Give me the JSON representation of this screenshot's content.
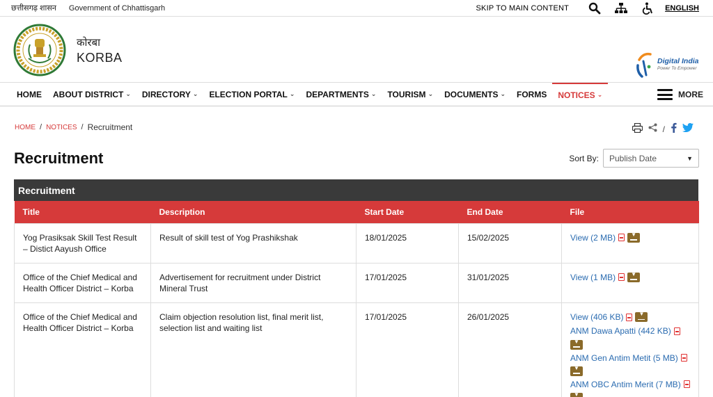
{
  "topbar": {
    "state_hindi": "छत्तीसगढ़ शासन",
    "state_english": "Government of Chhattisgarh",
    "skip": "SKIP TO MAIN CONTENT",
    "language": "ENGLISH",
    "icons": [
      "search-icon",
      "sitemap-icon",
      "accessibility-icon"
    ]
  },
  "header": {
    "district_hindi": "कोरबा",
    "district_english": "KORBA",
    "digital_india_title": "Digital India",
    "digital_india_tagline": "Power To Empower"
  },
  "nav": {
    "items": [
      {
        "label": "HOME",
        "dropdown": false
      },
      {
        "label": "ABOUT DISTRICT",
        "dropdown": true
      },
      {
        "label": "DIRECTORY",
        "dropdown": true
      },
      {
        "label": "ELECTION PORTAL",
        "dropdown": true
      },
      {
        "label": "DEPARTMENTS",
        "dropdown": true
      },
      {
        "label": "TOURISM",
        "dropdown": true
      },
      {
        "label": "DOCUMENTS",
        "dropdown": true
      },
      {
        "label": "FORMS",
        "dropdown": false
      },
      {
        "label": "NOTICES",
        "dropdown": true,
        "active": true
      }
    ],
    "more": "MORE"
  },
  "breadcrumb": {
    "home": "HOME",
    "notices": "NOTICES",
    "current": "Recruitment"
  },
  "share_sep": "/",
  "page_title": "Recruitment",
  "sort": {
    "label": "Sort By:",
    "value": "Publish Date"
  },
  "table": {
    "caption": "Recruitment",
    "headers": [
      "Title",
      "Description",
      "Start Date",
      "End Date",
      "File"
    ],
    "rows": [
      {
        "title": "Yog Prasiksak Skill Test Result – Distict Aayush Office",
        "description": "Result of skill test of Yog Prashikshak",
        "start": "18/01/2025",
        "end": "15/02/2025",
        "files": [
          "View (2 MB)"
        ]
      },
      {
        "title": "Office of the Chief Medical and Health Officer District – Korba",
        "description": "Advertisement for recruitment under District Mineral Trust",
        "start": "17/01/2025",
        "end": "31/01/2025",
        "files": [
          "View (1 MB)"
        ]
      },
      {
        "title": "Office of the Chief Medical and Health Officer District – Korba",
        "description": "Claim objection resolution list, final merit list, selection list and waiting list",
        "start": "17/01/2025",
        "end": "26/01/2025",
        "files": [
          "View (406 KB)",
          "ANM Dawa Apatti (442 KB)",
          "ANM Gen Antim Metit (5 MB)",
          "ANM OBC Antim Merit (7 MB)"
        ]
      }
    ]
  },
  "colors": {
    "accent_red": "#d63a3a",
    "caption_dark": "#3a3a3a",
    "link_blue": "#2a6bb0",
    "download_brown": "#8a6a2a"
  }
}
